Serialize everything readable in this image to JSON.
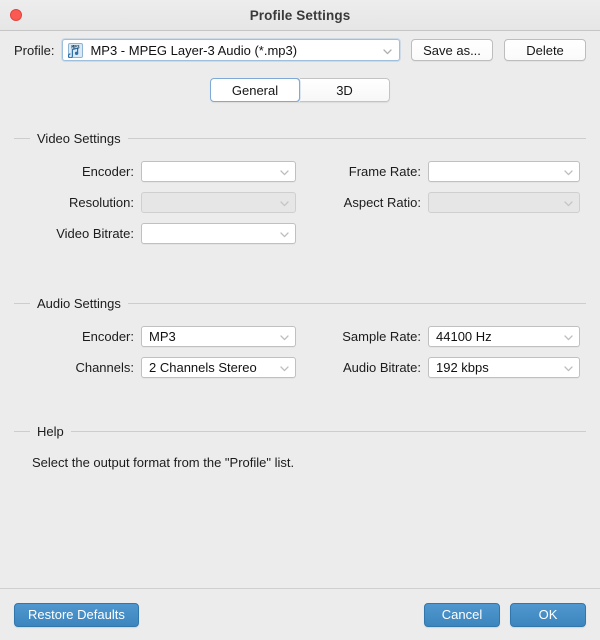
{
  "window": {
    "title": "Profile Settings",
    "close_icon": "close-button-red"
  },
  "profile_bar": {
    "label": "Profile:",
    "selected_profile": "MP3 - MPEG Layer-3 Audio (*.mp3)",
    "profile_icon": "mp3-file-icon",
    "dropdown_icon": "chevron-down-icon",
    "save_as_label": "Save as...",
    "delete_label": "Delete"
  },
  "tabs": [
    {
      "label": "General",
      "selected": true
    },
    {
      "label": "3D",
      "selected": false
    }
  ],
  "video_settings": {
    "title": "Video Settings",
    "fields": [
      {
        "label": "Encoder:",
        "value": "",
        "disabled": false
      },
      {
        "label": "Frame Rate:",
        "value": "",
        "disabled": false
      },
      {
        "label": "Resolution:",
        "value": "",
        "disabled": true
      },
      {
        "label": "Aspect Ratio:",
        "value": "",
        "disabled": true
      },
      {
        "label": "Video Bitrate:",
        "value": "",
        "disabled": false
      }
    ]
  },
  "audio_settings": {
    "title": "Audio Settings",
    "fields": [
      {
        "label": "Encoder:",
        "value": "MP3"
      },
      {
        "label": "Sample Rate:",
        "value": "44100 Hz"
      },
      {
        "label": "Channels:",
        "value": "2 Channels Stereo"
      },
      {
        "label": "Audio Bitrate:",
        "value": "192 kbps"
      }
    ]
  },
  "help": {
    "title": "Help",
    "text": "Select the output format from the \"Profile\" list."
  },
  "footer": {
    "restore_defaults_label": "Restore Defaults",
    "cancel_label": "Cancel",
    "ok_label": "OK"
  },
  "colors": {
    "window_background": "#ececec",
    "accent_blue": "#4189c4",
    "close_red": "#fb5a53",
    "selected_tab_border": "#7fa9d6"
  }
}
